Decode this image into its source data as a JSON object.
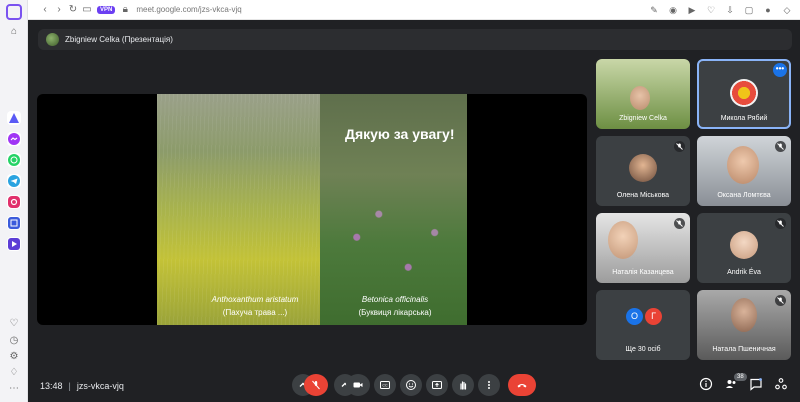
{
  "browser": {
    "url": "meet.google.com/jzs-vkca-vjq",
    "vpn_label": "VPN"
  },
  "presentation_chip": {
    "label": "Zbigniew Celka (Презентація)"
  },
  "slide": {
    "title": "Дякую за увагу!",
    "caption_left_latin": "Anthoxanthum aristatum",
    "caption_left_local": "(Пахуча трава ...)",
    "caption_right_latin": "Betonica officinalis",
    "caption_right_local": "(Буквиця лікарська)"
  },
  "participants": [
    {
      "name": "Zbigniew Celka"
    },
    {
      "name": "Микола Рябий"
    },
    {
      "name": "Олена Міськова"
    },
    {
      "name": "Оксана Ломтєва"
    },
    {
      "name": "Наталія Казанцева"
    },
    {
      "name": "Andrik Éva"
    },
    {
      "name": "Ще 30 осіб",
      "avatars": [
        "О",
        "Г"
      ]
    },
    {
      "name": "Натала Пшеничная"
    }
  ],
  "bottom_bar": {
    "time": "13:48",
    "meeting_code": "jzs-vkca-vjq",
    "participants_count": "38"
  },
  "colors": {
    "stage_bg": "#202124",
    "tile_bg": "#3c4043",
    "end_call": "#ea4335",
    "accent_blue": "#1a73e8"
  }
}
